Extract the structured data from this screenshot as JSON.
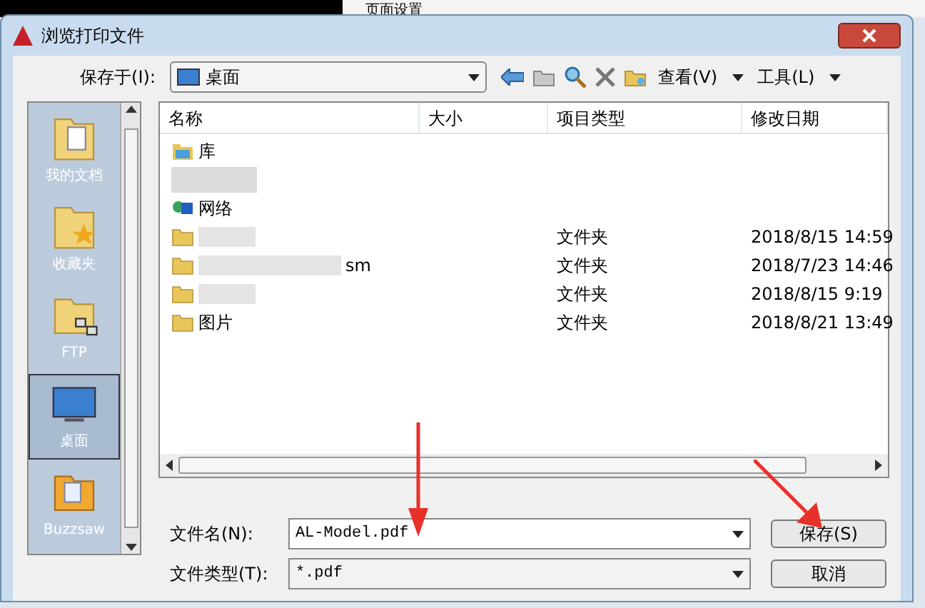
{
  "background": {
    "menu_text": "页面设置"
  },
  "window": {
    "title": "浏览打印文件"
  },
  "location": {
    "label": "保存于(I):",
    "value": "桌面"
  },
  "toolbar": {
    "view": "查看(V)",
    "tools": "工具(L)"
  },
  "places": [
    {
      "kind": "documents",
      "label": "我的文档",
      "selected": false
    },
    {
      "kind": "favorites",
      "label": "收藏夹",
      "selected": false
    },
    {
      "kind": "ftp",
      "label": "FTP",
      "selected": false
    },
    {
      "kind": "desktop",
      "label": "桌面",
      "selected": true
    },
    {
      "kind": "buzzsaw",
      "label": "Buzzsaw",
      "selected": false
    }
  ],
  "table": {
    "columns": [
      "名称",
      "大小",
      "项目类型",
      "修改日期"
    ],
    "rows": [
      {
        "kind": "library",
        "name": "库"
      },
      {
        "kind": "blurred"
      },
      {
        "kind": "network",
        "name": "网络"
      },
      {
        "kind": "folder",
        "type": "文件夹",
        "date": "2018/8/15 14:59"
      },
      {
        "kind": "folder",
        "name": "sm",
        "type": "文件夹",
        "date": "2018/7/23 14:46"
      },
      {
        "kind": "folder",
        "type": "文件夹",
        "date": "2018/8/15 9:19"
      },
      {
        "kind": "folder",
        "name": "图片",
        "type": "文件夹",
        "date": "2018/8/21 13:49"
      }
    ]
  },
  "file_name": {
    "label": "文件名(N):",
    "value": "AL-Model.pdf"
  },
  "file_type": {
    "label": "文件类型(T):",
    "value": "*.pdf"
  },
  "buttons": [
    {
      "label": "保存(S)"
    },
    {
      "label": "取消"
    }
  ]
}
